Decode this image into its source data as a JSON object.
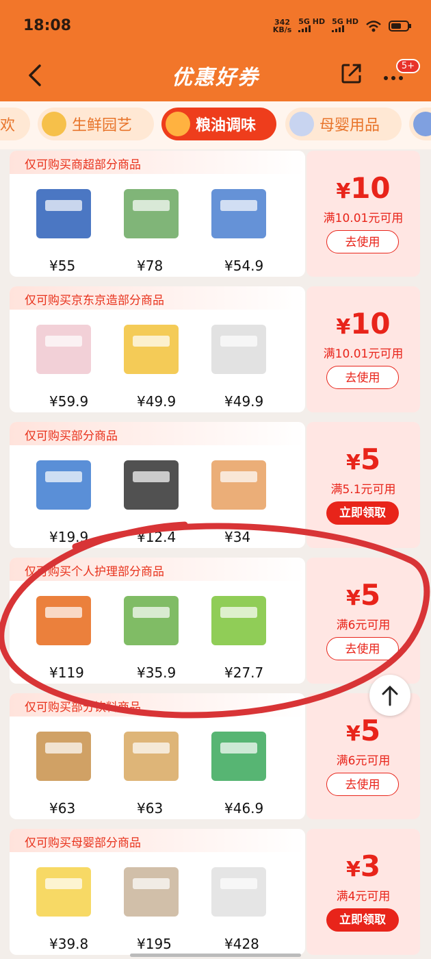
{
  "status_bar": {
    "time": "18:08",
    "speed": "342",
    "speed_unit": "KB/s",
    "network1": "5G HD",
    "network2": "5G HD"
  },
  "header": {
    "title": "优惠好券",
    "more_badge": "5+"
  },
  "tabs": [
    {
      "label": "欢",
      "active": false
    },
    {
      "label": "生鲜园艺",
      "active": false
    },
    {
      "label": "粮油调味",
      "active": true
    },
    {
      "label": "母婴用品",
      "active": false
    }
  ],
  "coupons": [
    {
      "scope": "仅可购买商超部分商品",
      "currency": "¥",
      "amount": "10",
      "condition": "满10.01元可用",
      "button": "去使用",
      "prices": [
        "¥55",
        "¥78",
        "¥54.9"
      ]
    },
    {
      "scope": "仅可购买京东京造部分商品",
      "currency": "¥",
      "amount": "10",
      "condition": "满10.01元可用",
      "button": "去使用",
      "prices": [
        "¥59.9",
        "¥49.9",
        "¥49.9"
      ]
    },
    {
      "scope": "仅可购买部分商品",
      "currency": "¥",
      "amount": "5",
      "condition": "满5.1元可用",
      "button": "立即领取",
      "prices": [
        "¥19.9",
        "¥12.4",
        "¥34"
      ]
    },
    {
      "scope": "仅可购买个人护理部分商品",
      "currency": "¥",
      "amount": "5",
      "condition": "满6元可用",
      "button": "去使用",
      "prices": [
        "¥119",
        "¥35.9",
        "¥27.7"
      ]
    },
    {
      "scope": "仅可购买部分饮料商品",
      "currency": "¥",
      "amount": "5",
      "condition": "满6元可用",
      "button": "去使用",
      "prices": [
        "¥63",
        "¥63",
        "¥46.9"
      ]
    },
    {
      "scope": "仅可购买母婴部分商品",
      "currency": "¥",
      "amount": "3",
      "condition": "满4元可用",
      "button": "立即领取",
      "prices": [
        "¥39.8",
        "¥195",
        "¥428"
      ]
    }
  ],
  "colors": {
    "brand": "#f2762a",
    "accent": "#e8241a"
  }
}
